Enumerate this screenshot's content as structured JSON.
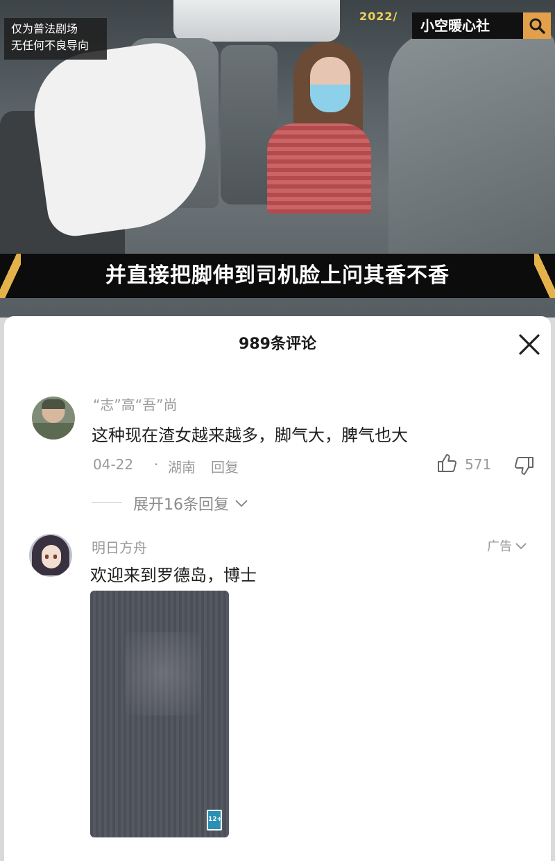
{
  "video": {
    "disclaimer_line1": "仅为普法剧场",
    "disclaimer_line2": "无任何不良导向",
    "date": "2022/",
    "channel": "小空暖心社",
    "caption": "并直接把脚伸到司机脸上问其香不香"
  },
  "sheet": {
    "title": "989条评论"
  },
  "comments": [
    {
      "username": "“志”高“吾”尚",
      "text": "这种现在渣女越来越多，脚气大，脾气也大",
      "date": "04-22",
      "separator": "·",
      "location": "湖南",
      "reply_label": "回复",
      "likes": "571",
      "expand_label": "展开16条回复"
    }
  ],
  "ad": {
    "username": "明日方舟",
    "tag": "广告",
    "text": "欢迎来到罗德岛，博士",
    "age_rating": "12+"
  },
  "colors": {
    "gold": "#e4b24a",
    "muted": "#9a9a9a",
    "text": "#1f1f1f"
  }
}
